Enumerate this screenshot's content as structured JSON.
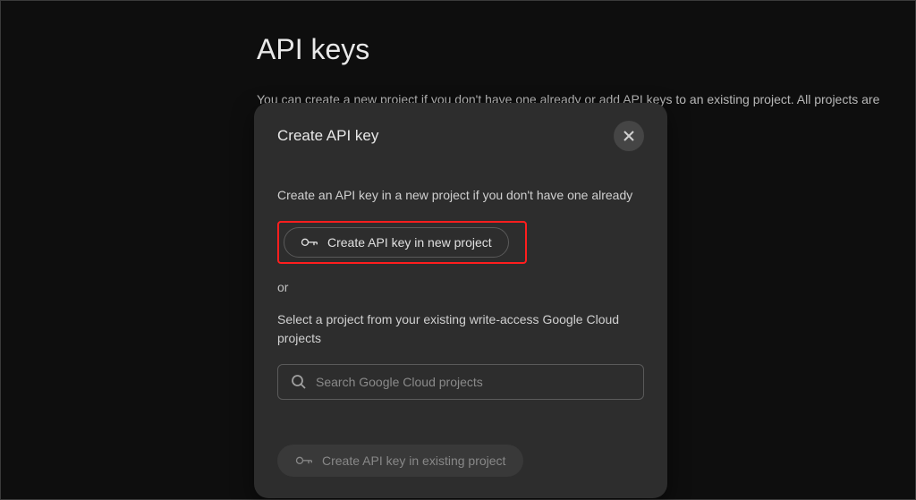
{
  "page": {
    "title": "API keys",
    "description": "You can create a new project if you don't have one already or add API keys to an existing project. All projects are"
  },
  "modal": {
    "title": "Create API key",
    "new_project_text": "Create an API key in a new project if you don't have one already",
    "btn_new_project": "Create API key in new project",
    "or_text": "or",
    "select_project_text": "Select a project from your existing write-access Google Cloud projects",
    "search_placeholder": "Search Google Cloud projects",
    "btn_existing_project": "Create API key in existing project"
  }
}
